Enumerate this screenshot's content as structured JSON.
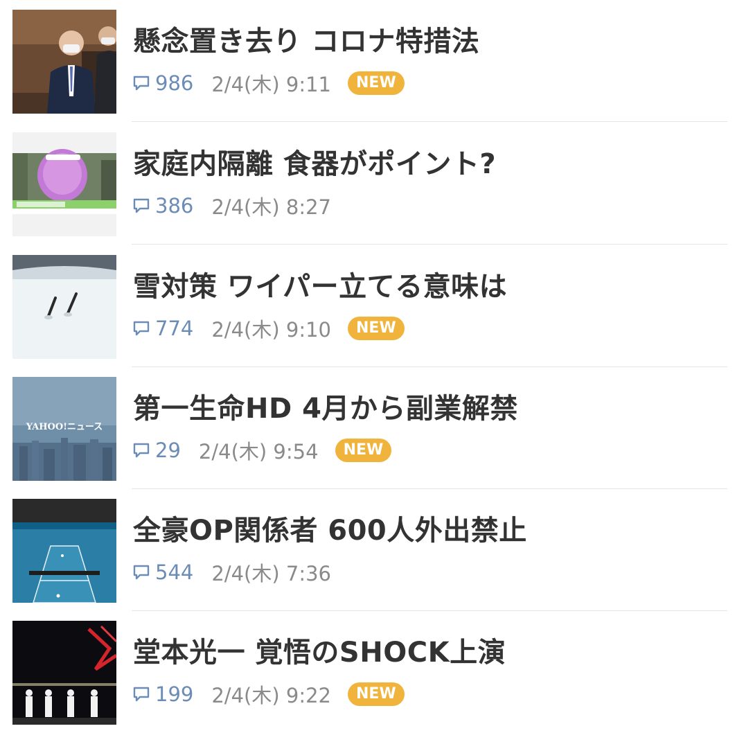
{
  "articles": [
    {
      "title": "懸念置き去り コロナ特措法",
      "comments": "986",
      "time": "2/4(木) 9:11",
      "new": true,
      "badge": "NEW",
      "thumb_icon": "politicians-photo-icon"
    },
    {
      "title": "家庭内隔離 食器がポイント?",
      "comments": "386",
      "time": "2/4(木) 8:27",
      "new": false,
      "badge": "",
      "thumb_icon": "tv-screen-photo-icon"
    },
    {
      "title": "雪対策 ワイパー立てる意味は",
      "comments": "774",
      "time": "2/4(木) 9:10",
      "new": true,
      "badge": "NEW",
      "thumb_icon": "snow-wiper-photo-icon"
    },
    {
      "title": "第一生命HD 4月から副業解禁",
      "comments": "29",
      "time": "2/4(木) 9:54",
      "new": true,
      "badge": "NEW",
      "thumb_icon": "yahoo-news-cityscape-icon",
      "thumb_text": "YAHOO!ニュース"
    },
    {
      "title": "全豪OP関係者 600人外出禁止",
      "comments": "544",
      "time": "2/4(木) 7:36",
      "new": false,
      "badge": "",
      "thumb_icon": "tennis-court-photo-icon"
    },
    {
      "title": "堂本光一 覚悟のSHOCK上演",
      "comments": "199",
      "time": "2/4(木) 9:22",
      "new": true,
      "badge": "NEW",
      "thumb_icon": "stage-performance-photo-icon"
    }
  ],
  "colors": {
    "title": "#333333",
    "count": "#6b8cb7",
    "time": "#8a8a8a",
    "badge": "#f0b43c",
    "divider": "#e5e5e5"
  }
}
